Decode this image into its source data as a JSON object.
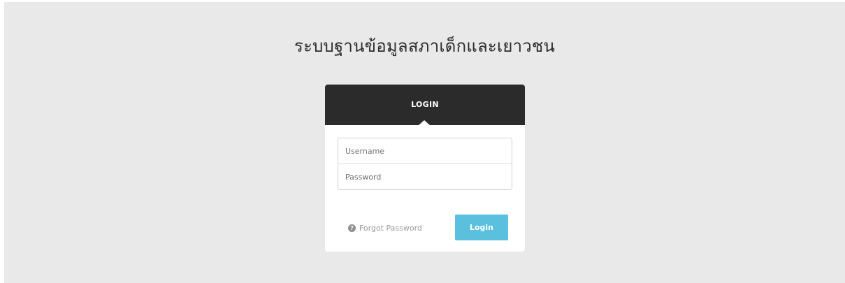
{
  "site": {
    "title": "ระบบฐานข้อมูลสภาเด็กและเยาวชน"
  },
  "login_card": {
    "header_title": "LOGIN",
    "username": {
      "placeholder": "Username",
      "value": ""
    },
    "password": {
      "placeholder": "Password",
      "value": ""
    },
    "forgot_password_label": "Forgot Password",
    "forgot_icon": "question-circle-icon",
    "login_button_label": "Login"
  },
  "colors": {
    "page_background": "#e9e9e9",
    "header_background": "#2b2b2b",
    "login_button": "#5bc0de",
    "card_background": "#ffffff"
  }
}
